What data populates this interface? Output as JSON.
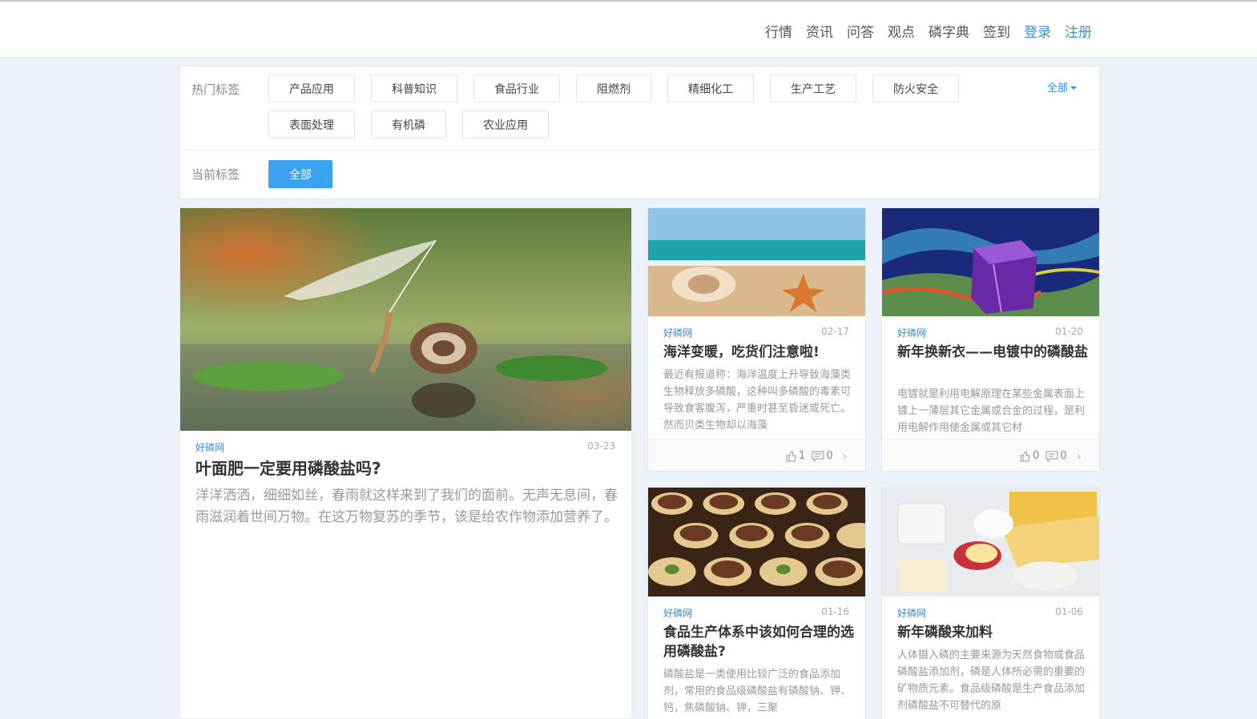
{
  "nav": {
    "items": [
      "行情",
      "资讯",
      "问答",
      "观点",
      "磷字典",
      "签到"
    ],
    "login": "登录",
    "register": "注册"
  },
  "tags": {
    "hot_label": "热门标签",
    "hot": [
      "产品应用",
      "科普知识",
      "食品行业",
      "阻燃剂",
      "精细化工",
      "生产工艺",
      "防火安全",
      "表面处理",
      "有机磷",
      "农业应用"
    ],
    "all_toggle": "全部",
    "current_label": "当前标签",
    "current": "全部"
  },
  "articles": [
    {
      "source": "好磷网",
      "date": "03-23",
      "title": "叶面肥一定要用磷酸盐吗?",
      "excerpt": "洋洋洒洒，细细如丝，春雨就这样来到了我们的面前。无声无息间，春雨滋润着世间万物。在这万物复苏的季节，该是给农作物添加营养了。",
      "image": "snail-photo"
    },
    {
      "source": "好磷网",
      "date": "02-17",
      "title": "海洋变暖，吃货们注意啦!",
      "excerpt": "最近有报道称：海洋温度上升导致海藻类生物释放多磷酸，这种叫多磷酸的毒素可导致食客腹泻，严重时甚至昏迷或死亡。然而贝类生物却以海藻",
      "likes": "1",
      "comments": "0",
      "image": "beach-shells-photo"
    },
    {
      "source": "好磷网",
      "date": "01-20",
      "title": "新年换新衣——电镀中的磷酸盐",
      "excerpt": "电镀就是利用电解原理在某些金属表面上镀上一薄层其它金属或合金的过程，是利用电解作用使金属或其它材",
      "likes": "0",
      "comments": "0",
      "image": "electroplating-photo"
    },
    {
      "source": "好磷网",
      "date": "01-16",
      "title": "食品生产体系中该如何合理的选用磷酸盐?",
      "excerpt": "磷酸盐是一类使用比较广泛的食品添加剂，常用的食品级磷酸盐有磷酸钠、钾、钙，焦磷酸钠、钾，三聚",
      "image": "chocolates-photo"
    },
    {
      "source": "好磷网",
      "date": "01-06",
      "title": "新年磷酸来加料",
      "excerpt": "人体摄入磷的主要来源为天然食物或食品磷酸盐添加剂，磷是人体所必需的重要的矿物质元素。食品级磷酸是生产食品添加剂磷酸盐不可替代的原",
      "image": "dairy-cheese-photo"
    }
  ]
}
